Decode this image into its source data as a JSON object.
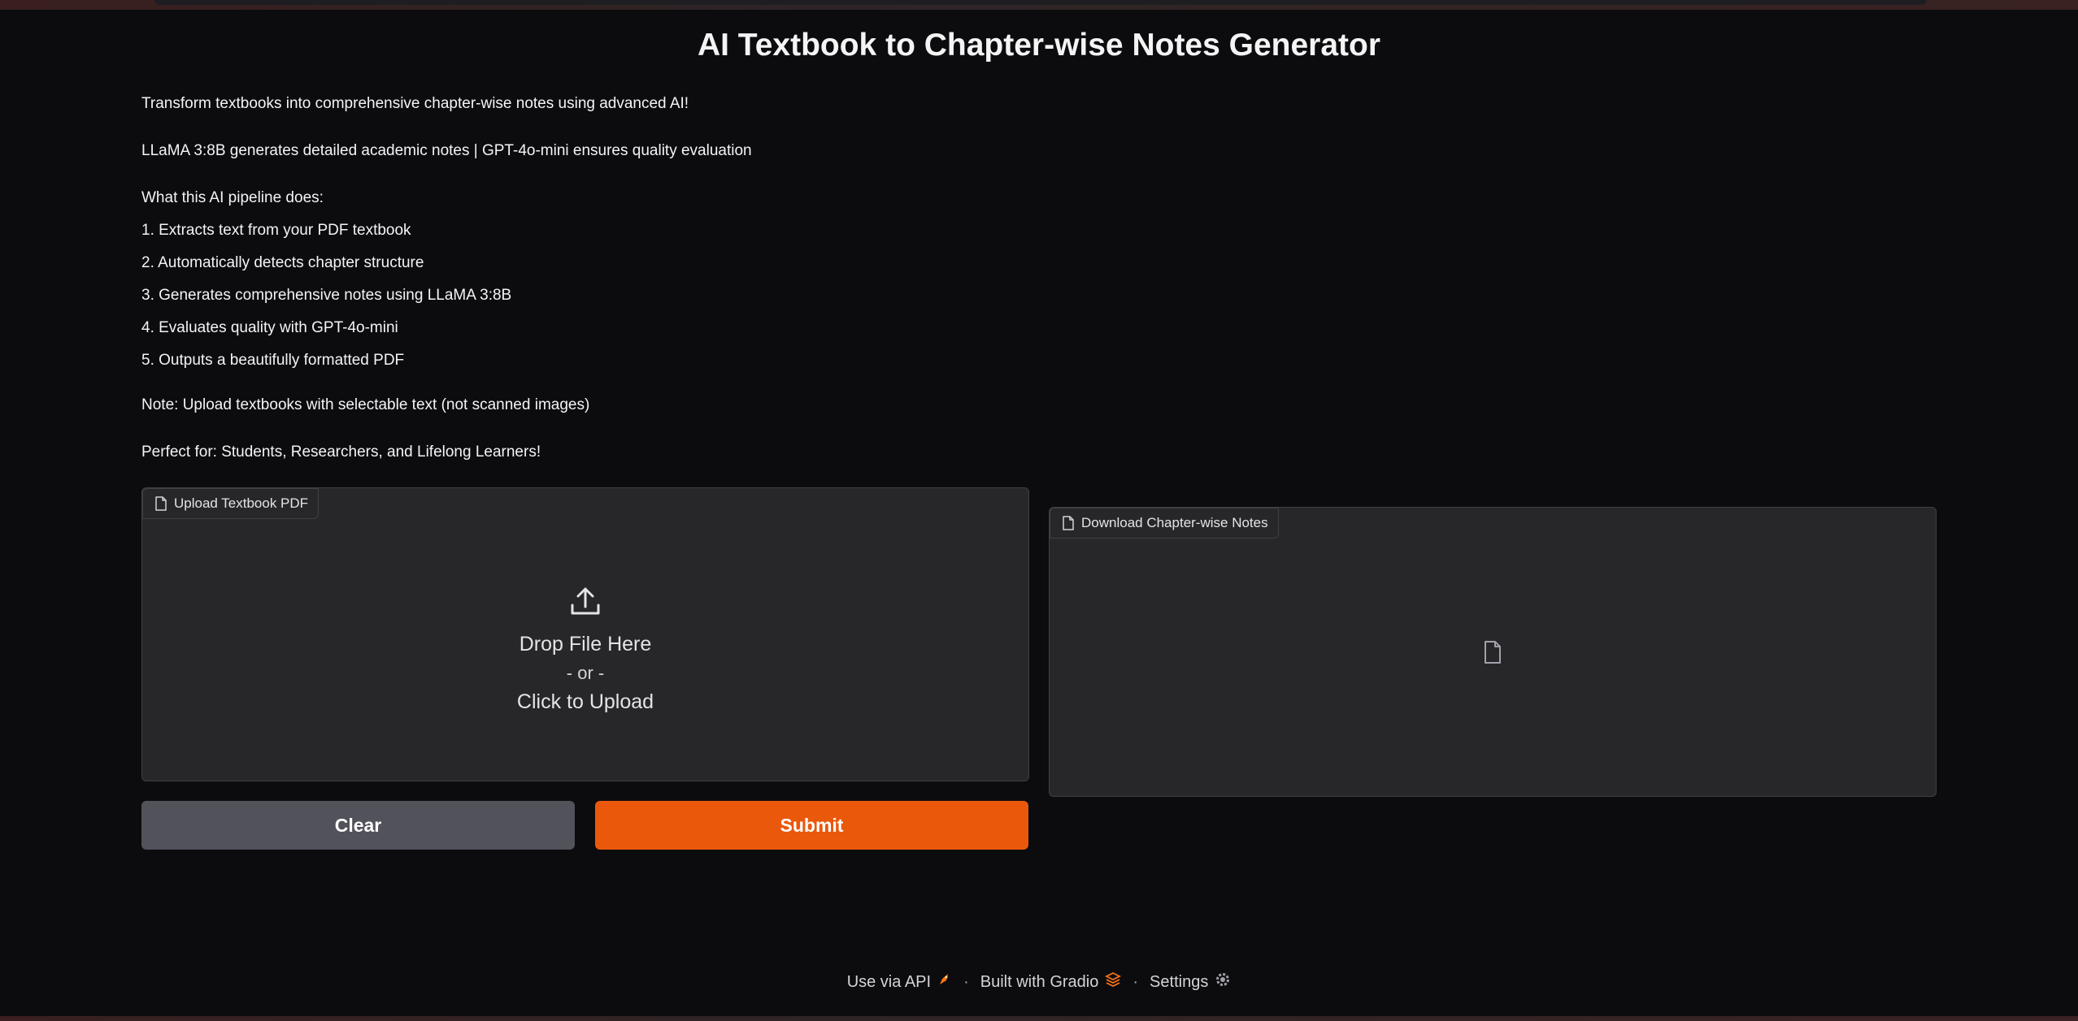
{
  "app": {
    "title": "AI Textbook to Chapter-wise Notes Generator"
  },
  "description": {
    "intro": "Transform textbooks into comprehensive chapter-wise notes using advanced AI!",
    "models": "LLaMA 3:8B generates detailed academic notes | GPT-4o-mini ensures quality evaluation",
    "pipeline_heading": "What this AI pipeline does:",
    "steps": [
      "1. Extracts text from your PDF textbook",
      "2. Automatically detects chapter structure",
      "3. Generates comprehensive notes using LLaMA 3:8B",
      "4. Evaluates quality with GPT-4o-mini",
      "5. Outputs a beautifully formatted PDF"
    ],
    "note": "Note: Upload textbooks with selectable text (not scanned images)",
    "audience": "Perfect for: Students, Researchers, and Lifelong Learners!"
  },
  "upload": {
    "label": "Upload Textbook PDF",
    "icon": "upload-icon",
    "drop_text": "Drop File Here",
    "or_text": "- or -",
    "click_text": "Click to Upload"
  },
  "download": {
    "label": "Download Chapter-wise Notes",
    "icon": "file-icon"
  },
  "buttons": {
    "clear": "Clear",
    "submit": "Submit"
  },
  "footer": {
    "api": "Use via API",
    "built": "Built with Gradio",
    "settings": "Settings",
    "separator": "·"
  },
  "colors": {
    "background": "#0c0c0f",
    "panel": "#27272a",
    "submit": "#ea580c",
    "clear": "#52525b"
  }
}
